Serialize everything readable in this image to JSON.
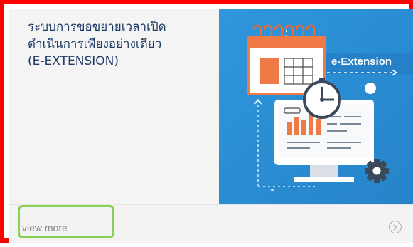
{
  "card": {
    "title_lines": [
      "ระบบการขอขยายเวลาเปิด",
      "ดำเนินการเพียงอย่างเดียว",
      "(E-EXTENSION)"
    ],
    "image": {
      "banner_text": "e-Extension",
      "icons": [
        "calendar-icon",
        "clock-icon",
        "monitor-icon",
        "gear-icon",
        "bar-chart-icon"
      ]
    },
    "footer": {
      "view_more_label": "view more",
      "arrow_icon": "chevron-right-circle-icon"
    }
  },
  "colors": {
    "frame": "#ff0000",
    "highlight": "#89d154",
    "title": "#1f3a67",
    "image_background": "#2d8fd5",
    "calendar_accent": "#f07a45",
    "muted_text": "#8a8a8a"
  }
}
